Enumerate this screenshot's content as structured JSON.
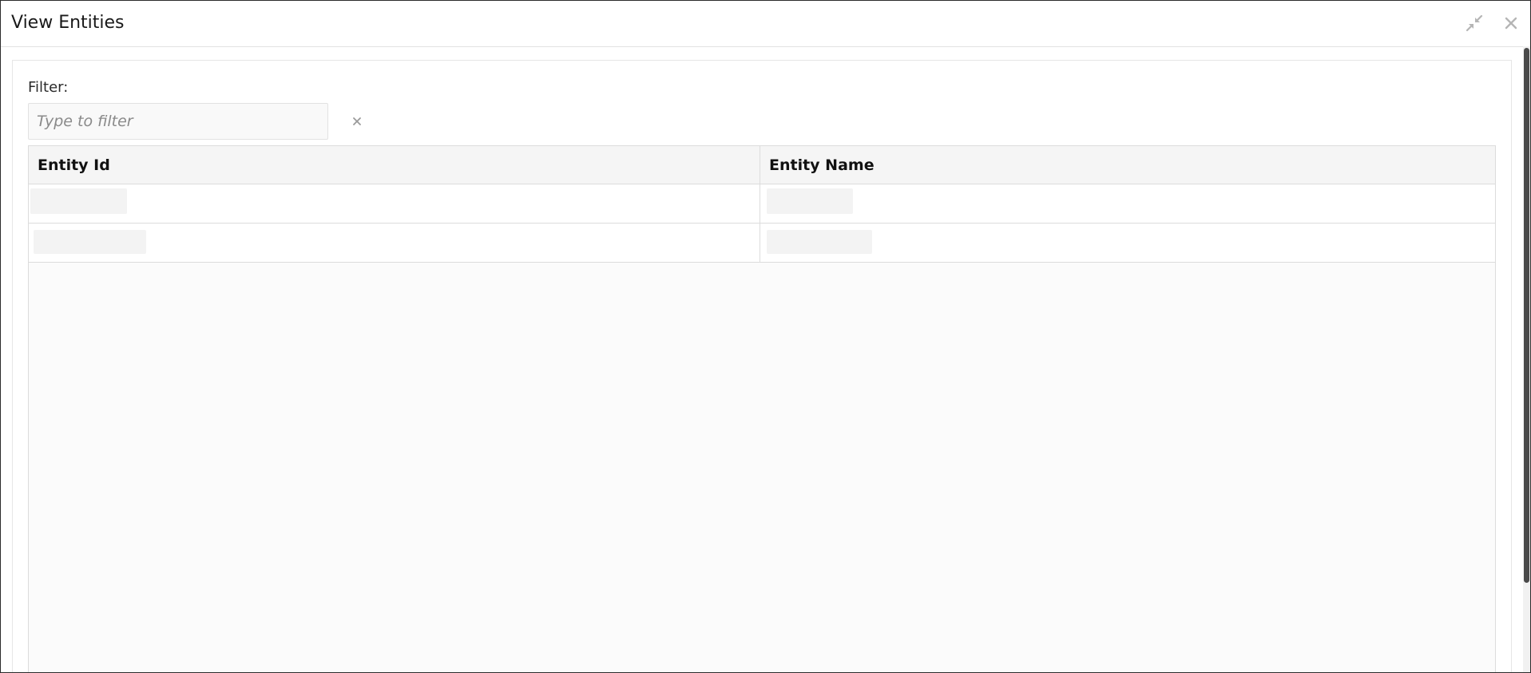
{
  "dialog": {
    "title": "View Entities",
    "icons": {
      "minimize": "compress-arrows-icon",
      "close": "close-icon"
    }
  },
  "filter": {
    "label": "Filter:",
    "placeholder": "Type to filter",
    "value": "",
    "clear_icon": "close-icon"
  },
  "table": {
    "columns": [
      "Entity Id",
      "Entity Name"
    ],
    "rows": [
      {
        "entity_id": "",
        "entity_name": ""
      },
      {
        "entity_id": "",
        "entity_name": ""
      }
    ]
  },
  "colors": {
    "header_background": "#f5f5f5",
    "border": "#dcdcdc",
    "icon_gray": "#b5b5b5",
    "scrollbar_thumb": "#4a4a4a"
  }
}
